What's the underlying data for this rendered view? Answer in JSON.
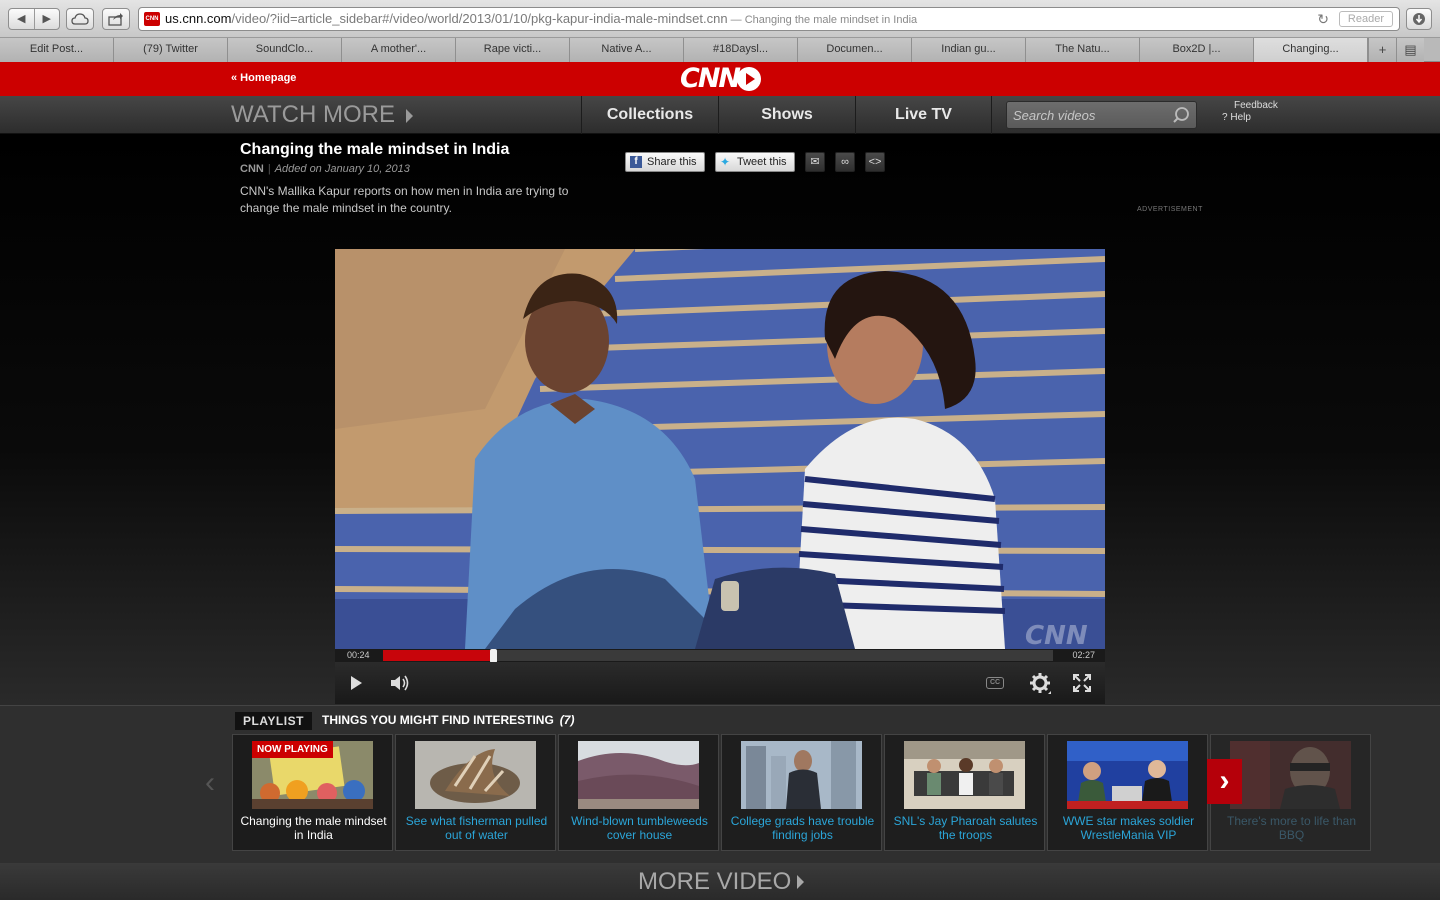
{
  "browser": {
    "url_domain": "us.cnn.com",
    "url_path": "/video/?iid=article_sidebar#/video/world/2013/01/10/pkg-kapur-india-male-mindset.cnn",
    "url_title": " — Changing the male mindset in India",
    "reader_label": "Reader",
    "favicon_text": "CNN",
    "tabs": [
      {
        "label": "Edit Post..."
      },
      {
        "label": "(79) Twitter"
      },
      {
        "label": "SoundClo..."
      },
      {
        "label": "A mother'..."
      },
      {
        "label": "Rape victi..."
      },
      {
        "label": "Native A..."
      },
      {
        "label": "#18Daysl..."
      },
      {
        "label": "Documen..."
      },
      {
        "label": "Indian gu..."
      },
      {
        "label": "The Natu..."
      },
      {
        "label": "Box2D |..."
      },
      {
        "label": "Changing..."
      }
    ],
    "new_tab_label": "+"
  },
  "header": {
    "homepage_label": "« Homepage",
    "logo_text": "CNN",
    "watch_more": "WATCH MORE",
    "nav": {
      "collections": "Collections",
      "shows": "Shows",
      "live_tv": "Live TV"
    },
    "search_placeholder": "Search videos",
    "feedback": "Feedback",
    "help": "Help"
  },
  "video": {
    "title": "Changing the male mindset in India",
    "source": "CNN",
    "added": "Added on January 10, 2013",
    "description": "CNN's Mallika Kapur reports on how men in India are trying to change the male mindset in the country.",
    "share_facebook": "Share this",
    "share_twitter": "Tweet this",
    "advertisement_label": "ADVERTISEMENT",
    "current_time": "00:24",
    "total_time": "02:27",
    "progress": 0.164,
    "watermark": "CNN",
    "cc_label": "CC"
  },
  "playlist": {
    "tag": "PLAYLIST",
    "heading": "THINGS YOU MIGHT FIND INTERESTING",
    "count": "(7)",
    "now_playing": "NOW PLAYING",
    "items": [
      {
        "caption": "Changing the male mindset in India"
      },
      {
        "caption": "See what fisherman pulled out of water"
      },
      {
        "caption": "Wind-blown tumbleweeds cover house"
      },
      {
        "caption": "College grads have trouble finding jobs"
      },
      {
        "caption": "SNL's Jay Pharoah salutes the troops"
      },
      {
        "caption": "WWE star makes soldier WrestleMania VIP"
      },
      {
        "caption": "There's more to life than BBQ"
      }
    ],
    "more_video": "MORE VIDEO"
  },
  "colors": {
    "cnn_red": "#cc0000",
    "link_blue": "#2ba5d8",
    "progress_red": "#c8050b"
  }
}
